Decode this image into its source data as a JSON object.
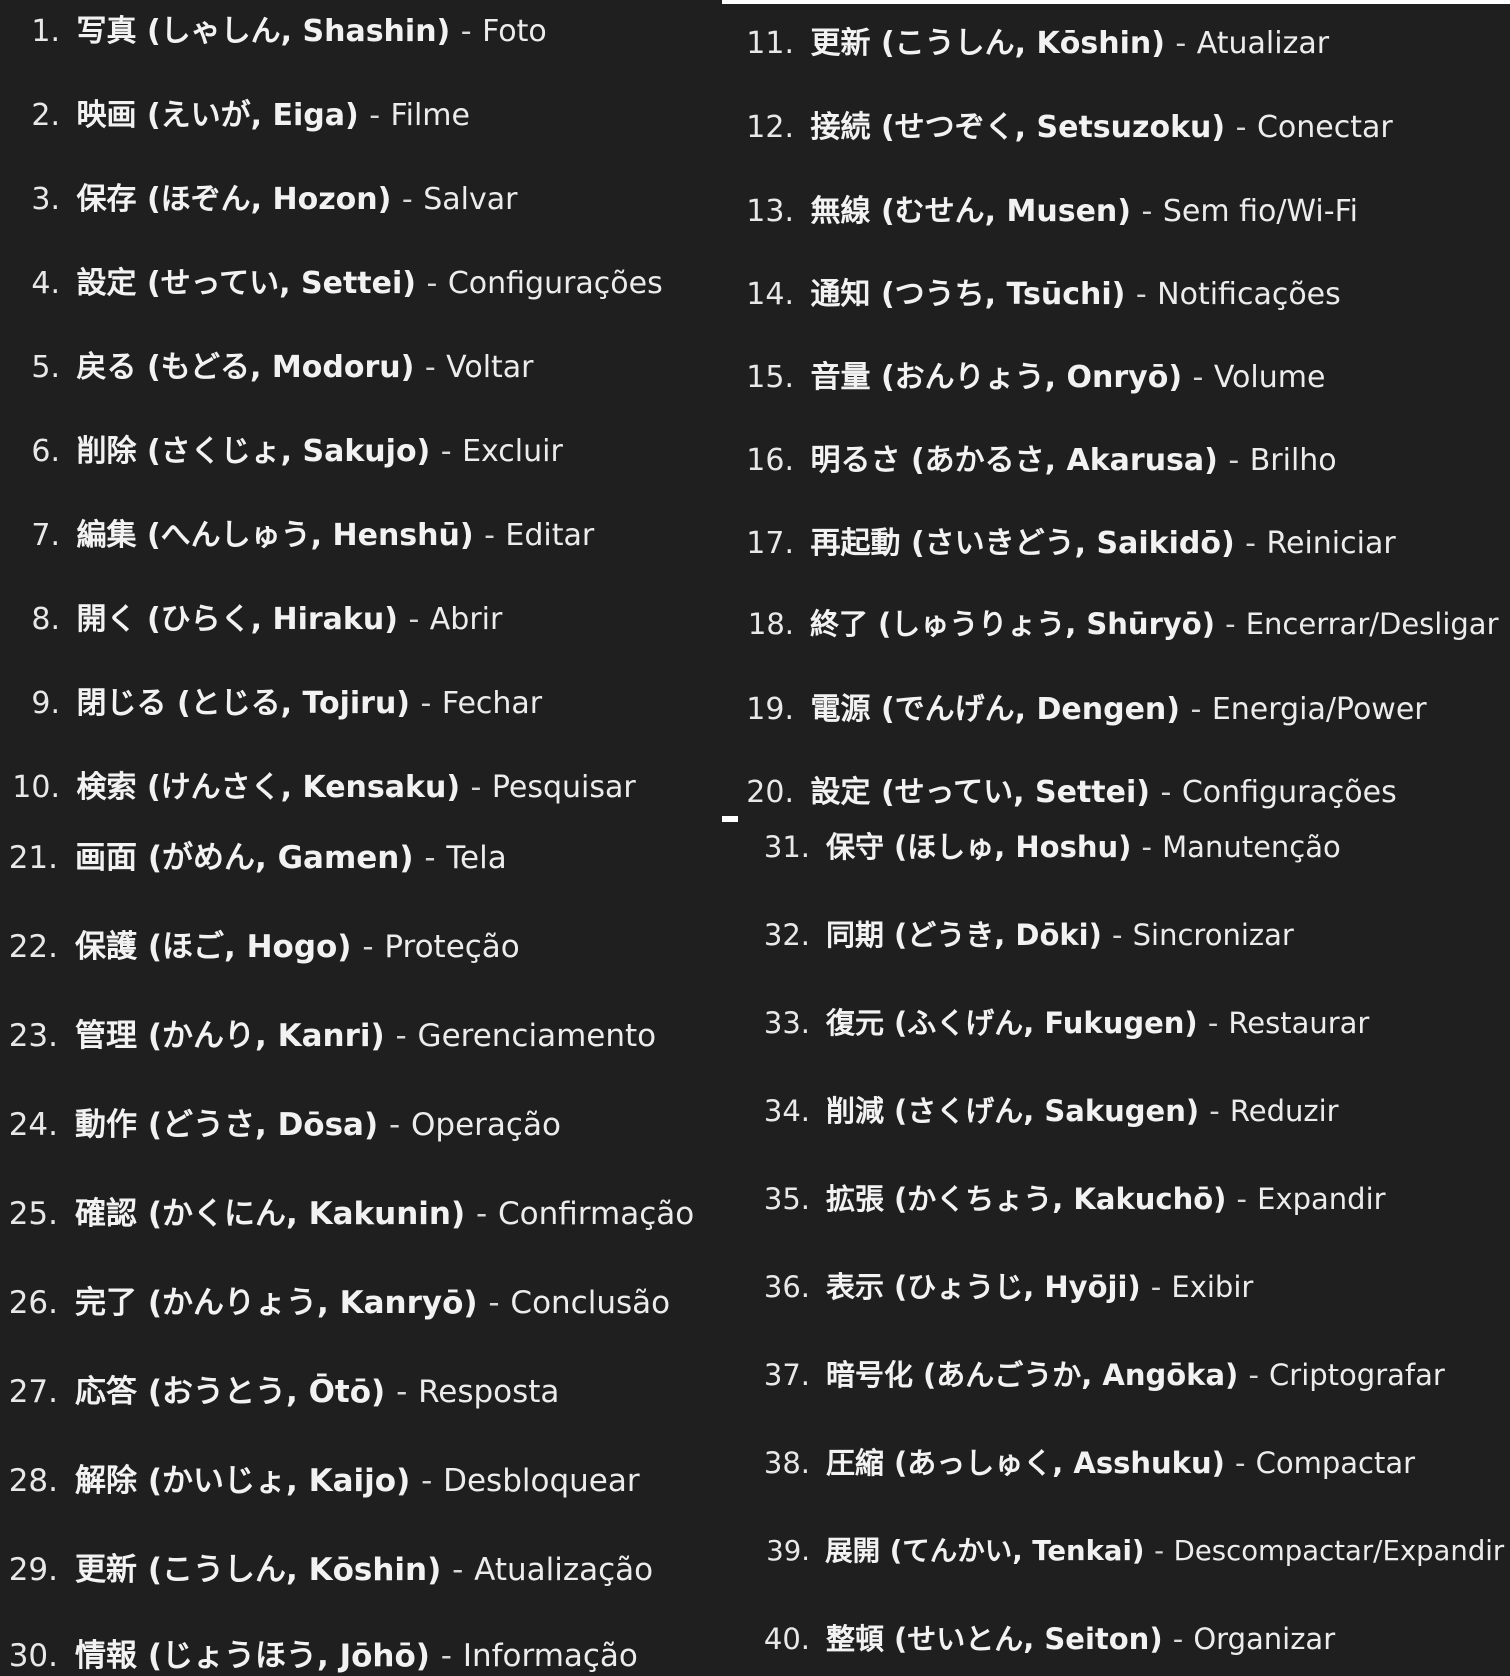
{
  "panels": [
    {
      "id": "panel-1",
      "items": [
        {
          "num": "1.",
          "term": "写真 (しゃしん, Shashin)",
          "meaning": "Foto"
        },
        {
          "num": "2.",
          "term": "映画 (えいが, Eiga)",
          "meaning": "Filme"
        },
        {
          "num": "3.",
          "term": "保存 (ほぞん, Hozon)",
          "meaning": "Salvar"
        },
        {
          "num": "4.",
          "term": "設定 (せってい, Settei)",
          "meaning": "Configurações"
        },
        {
          "num": "5.",
          "term": "戻る (もどる, Modoru)",
          "meaning": "Voltar"
        },
        {
          "num": "6.",
          "term": "削除 (さくじょ, Sakujo)",
          "meaning": "Excluir"
        },
        {
          "num": "7.",
          "term": "編集 (へんしゅう, Henshū)",
          "meaning": "Editar"
        },
        {
          "num": "8.",
          "term": "開く (ひらく, Hiraku)",
          "meaning": "Abrir"
        },
        {
          "num": "9.",
          "term": "閉じる (とじる, Tojiru)",
          "meaning": "Fechar"
        },
        {
          "num": "10.",
          "term": "検索 (けんさく, Kensaku)",
          "meaning": "Pesquisar"
        }
      ]
    },
    {
      "id": "panel-2",
      "items": [
        {
          "num": "11.",
          "term": "更新 (こうしん, Kōshin)",
          "meaning": "Atualizar"
        },
        {
          "num": "12.",
          "term": "接続 (せつぞく, Setsuzoku)",
          "meaning": "Conectar"
        },
        {
          "num": "13.",
          "term": "無線 (むせん, Musen)",
          "meaning": "Sem fio/Wi-Fi"
        },
        {
          "num": "14.",
          "term": "通知 (つうち, Tsūchi)",
          "meaning": "Notificações"
        },
        {
          "num": "15.",
          "term": "音量 (おんりょう, Onryō)",
          "meaning": "Volume"
        },
        {
          "num": "16.",
          "term": "明るさ (あかるさ, Akarusa)",
          "meaning": "Brilho"
        },
        {
          "num": "17.",
          "term": "再起動 (さいきどう, Saikidō)",
          "meaning": "Reiniciar"
        },
        {
          "num": "18.",
          "term": "終了 (しゅうりょう, Shūryō)",
          "meaning": "Encerrar/Desligar"
        },
        {
          "num": "19.",
          "term": "電源 (でんげん, Dengen)",
          "meaning": "Energia/Power"
        },
        {
          "num": "20.",
          "term": "設定 (せってい, Settei)",
          "meaning": "Configurações"
        }
      ]
    },
    {
      "id": "panel-3",
      "items": [
        {
          "num": "21.",
          "term": "画面 (がめん, Gamen)",
          "meaning": "Tela"
        },
        {
          "num": "22.",
          "term": "保護 (ほご, Hogo)",
          "meaning": "Proteção"
        },
        {
          "num": "23.",
          "term": "管理 (かんり, Kanri)",
          "meaning": "Gerenciamento"
        },
        {
          "num": "24.",
          "term": "動作 (どうさ, Dōsa)",
          "meaning": "Operação"
        },
        {
          "num": "25.",
          "term": "確認 (かくにん, Kakunin)",
          "meaning": "Confirmação"
        },
        {
          "num": "26.",
          "term": "完了 (かんりょう, Kanryō)",
          "meaning": "Conclusão"
        },
        {
          "num": "27.",
          "term": "応答 (おうとう, Ōtō)",
          "meaning": "Resposta"
        },
        {
          "num": "28.",
          "term": "解除 (かいじょ, Kaijo)",
          "meaning": "Desbloquear"
        },
        {
          "num": "29.",
          "term": "更新 (こうしん, Kōshin)",
          "meaning": "Atualização"
        },
        {
          "num": "30.",
          "term": "情報 (じょうほう, Jōhō)",
          "meaning": "Informação"
        }
      ]
    },
    {
      "id": "panel-4",
      "items": [
        {
          "num": "31.",
          "term": "保守 (ほしゅ, Hoshu)",
          "meaning": "Manutenção"
        },
        {
          "num": "32.",
          "term": "同期 (どうき, Dōki)",
          "meaning": "Sincronizar"
        },
        {
          "num": "33.",
          "term": "復元 (ふくげん, Fukugen)",
          "meaning": "Restaurar"
        },
        {
          "num": "34.",
          "term": "削減 (さくげん, Sakugen)",
          "meaning": "Reduzir"
        },
        {
          "num": "35.",
          "term": "拡張 (かくちょう, Kakuchō)",
          "meaning": "Expandir"
        },
        {
          "num": "36.",
          "term": "表示 (ひょうじ, Hyōji)",
          "meaning": "Exibir"
        },
        {
          "num": "37.",
          "term": "暗号化 (あんごうか, Angōka)",
          "meaning": "Criptografar"
        },
        {
          "num": "38.",
          "term": "圧縮 (あっしゅく, Asshuku)",
          "meaning": "Compactar"
        },
        {
          "num": "39.",
          "term": "展開 (てんかい, Tenkai)",
          "meaning": "Descompactar/Expandir"
        },
        {
          "num": "40.",
          "term": "整頓 (せいとん, Seiton)",
          "meaning": "Organizar"
        }
      ]
    }
  ]
}
